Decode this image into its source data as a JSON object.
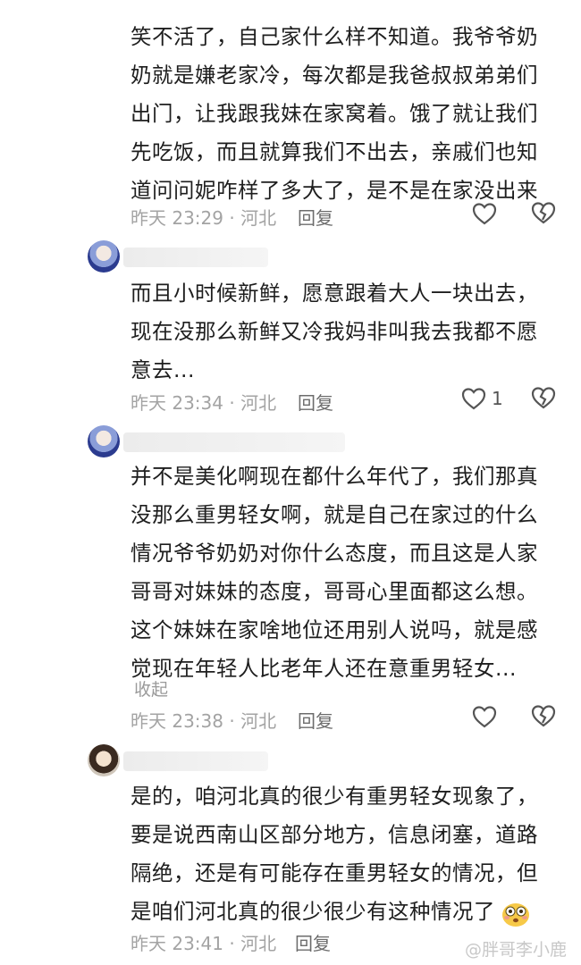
{
  "comments": [
    {
      "text": "笑不活了，自己家什么样不知道。我爷爷奶奶就是嫌老家冷，每次都是我爸叔叔弟弟们出门，让我跟我妹在家窝着。饿了就让我们先吃饭，而且就算我们不出去，亲戚们也知道问问妮咋样了多大了，是不是在家没出来",
      "time_location": "昨天 23:29 · 河北",
      "reply": "回复"
    },
    {
      "text": "而且小时候新鲜，愿意跟着大人一块出去，现在没那么新鲜又冷我妈非叫我去我都不愿意去...",
      "time_location": "昨天 23:34 · 河北",
      "reply": "回复",
      "like_count": "1"
    },
    {
      "text": "并不是美化啊现在都什么年代了，我们那真没那么重男轻女啊，就是自己在家过的什么情况爷爷奶奶对你什么态度，而且这是人家哥哥对妹妹的态度，哥哥心里面都这么想。这个妹妹在家啥地位还用别人说吗，就是感觉现在年轻人比老年人还在意重男轻女...",
      "collapse": "收起",
      "time_location": "昨天 23:38 · 河北",
      "reply": "回复"
    },
    {
      "text": "是的，咱河北真的很少有重男轻女现象了，要是说西南山区部分地方，信息闭塞，道路隔绝，还是有可能存在重男轻女的情况，但是咱们河北真的很少很少有这种情况了",
      "time_location": "昨天 23:41 · 河北",
      "reply": "回复"
    }
  ],
  "watermark": "@胖哥李小鹿",
  "icons": {
    "like": "heart-outline-icon",
    "dislike": "broken-heart-outline-icon",
    "emoji": "flushed-face-emoji-icon"
  },
  "colors": {
    "text": "#1e1e1e",
    "meta": "#a3a3a3",
    "reply": "#6c6c6c"
  }
}
